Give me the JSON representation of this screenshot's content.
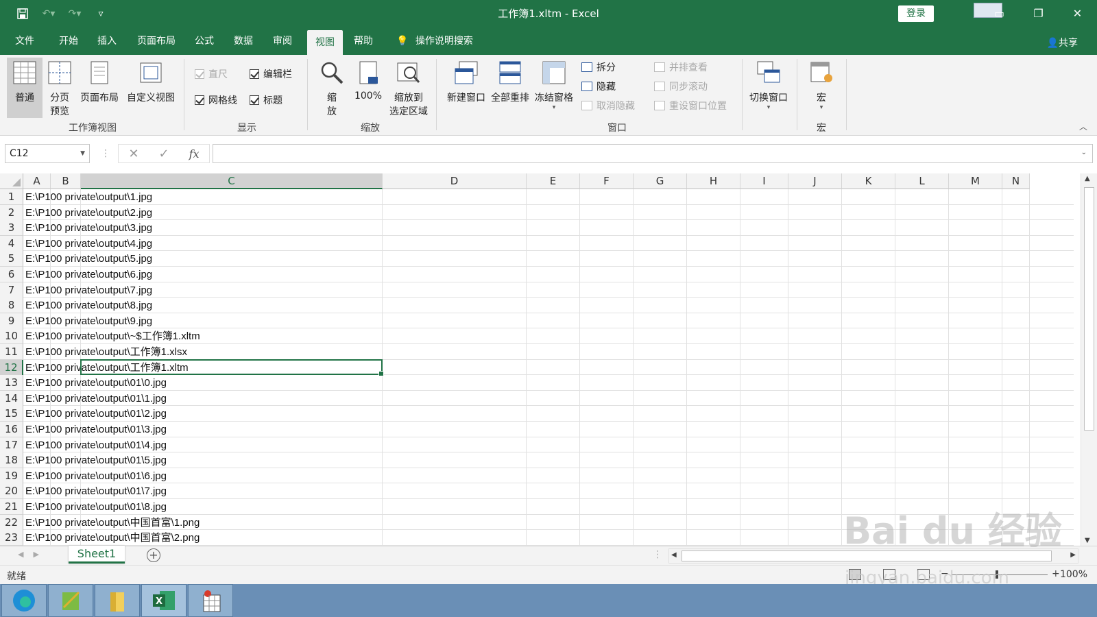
{
  "titlebar": {
    "title": "工作簿1.xltm  -  Excel",
    "login": "登录"
  },
  "tabs": [
    "文件",
    "开始",
    "插入",
    "页面布局",
    "公式",
    "数据",
    "审阅",
    "视图",
    "帮助"
  ],
  "active_tab": "视图",
  "search": "操作说明搜索",
  "share": "共享",
  "ribbon": {
    "workbook_views": {
      "label": "工作簿视图",
      "normal": "普通",
      "page_break_1": "分页",
      "page_break_2": "预览",
      "page_layout": "页面布局",
      "custom_views": "自定义视图"
    },
    "show": {
      "label": "显示",
      "ruler": "直尺",
      "formula_bar": "编辑栏",
      "gridlines": "网格线",
      "headings": "标题"
    },
    "zoom": {
      "label": "缩放",
      "zoom_1": "缩",
      "zoom_2": "放",
      "hundred": "100%",
      "zoom_sel_1": "缩放到",
      "zoom_sel_2": "选定区域"
    },
    "window": {
      "label": "窗口",
      "new_window": "新建窗口",
      "arrange_all": "全部重排",
      "freeze": "冻结窗格",
      "split": "拆分",
      "hide": "隐藏",
      "unhide": "取消隐藏",
      "side_by_side": "并排查看",
      "sync_scroll": "同步滚动",
      "reset_pos": "重设窗口位置",
      "switch": "切换窗口"
    },
    "macros": {
      "label": "宏",
      "macros": "宏"
    }
  },
  "formula_bar": {
    "name_box": "C12",
    "fx": "fx",
    "value": ""
  },
  "columns": [
    "A",
    "B",
    "C",
    "D",
    "E",
    "F",
    "G",
    "H",
    "I",
    "J",
    "K",
    "L",
    "M",
    "N"
  ],
  "selected_column": "C",
  "selected_row": 12,
  "rows": [
    {
      "n": "1",
      "text": "E:\\P100 private\\output\\1.jpg"
    },
    {
      "n": "2",
      "text": "E:\\P100 private\\output\\2.jpg"
    },
    {
      "n": "3",
      "text": "E:\\P100 private\\output\\3.jpg"
    },
    {
      "n": "4",
      "text": "E:\\P100 private\\output\\4.jpg"
    },
    {
      "n": "5",
      "text": "E:\\P100 private\\output\\5.jpg"
    },
    {
      "n": "6",
      "text": "E:\\P100 private\\output\\6.jpg"
    },
    {
      "n": "7",
      "text": "E:\\P100 private\\output\\7.jpg"
    },
    {
      "n": "8",
      "text": "E:\\P100 private\\output\\8.jpg"
    },
    {
      "n": "9",
      "text": "E:\\P100 private\\output\\9.jpg"
    },
    {
      "n": "10",
      "text": "E:\\P100 private\\output\\~$工作簿1.xltm"
    },
    {
      "n": "11",
      "text": "E:\\P100 private\\output\\工作簿1.xlsx"
    },
    {
      "n": "12",
      "text": "E:\\P100 private\\output\\工作簿1.xltm"
    },
    {
      "n": "13",
      "text": "E:\\P100 private\\output\\01\\0.jpg"
    },
    {
      "n": "14",
      "text": "E:\\P100 private\\output\\01\\1.jpg"
    },
    {
      "n": "15",
      "text": "E:\\P100 private\\output\\01\\2.jpg"
    },
    {
      "n": "16",
      "text": "E:\\P100 private\\output\\01\\3.jpg"
    },
    {
      "n": "17",
      "text": "E:\\P100 private\\output\\01\\4.jpg"
    },
    {
      "n": "18",
      "text": "E:\\P100 private\\output\\01\\5.jpg"
    },
    {
      "n": "19",
      "text": "E:\\P100 private\\output\\01\\6.jpg"
    },
    {
      "n": "20",
      "text": "E:\\P100 private\\output\\01\\7.jpg"
    },
    {
      "n": "21",
      "text": "E:\\P100 private\\output\\01\\8.jpg"
    },
    {
      "n": "22",
      "text": "E:\\P100 private\\output\\中国首富\\1.png"
    },
    {
      "n": "23",
      "text": "E:\\P100 private\\output\\中国首富\\2.png"
    }
  ],
  "sheet_tab": "Sheet1",
  "status": {
    "ready": "就绪",
    "zoom": "100%"
  },
  "watermark": {
    "brand": "Bai du 经验",
    "url": "jingyan.baidu.com"
  },
  "colors": {
    "accent": "#217346",
    "ribbon_bg": "#f3f3f3"
  }
}
